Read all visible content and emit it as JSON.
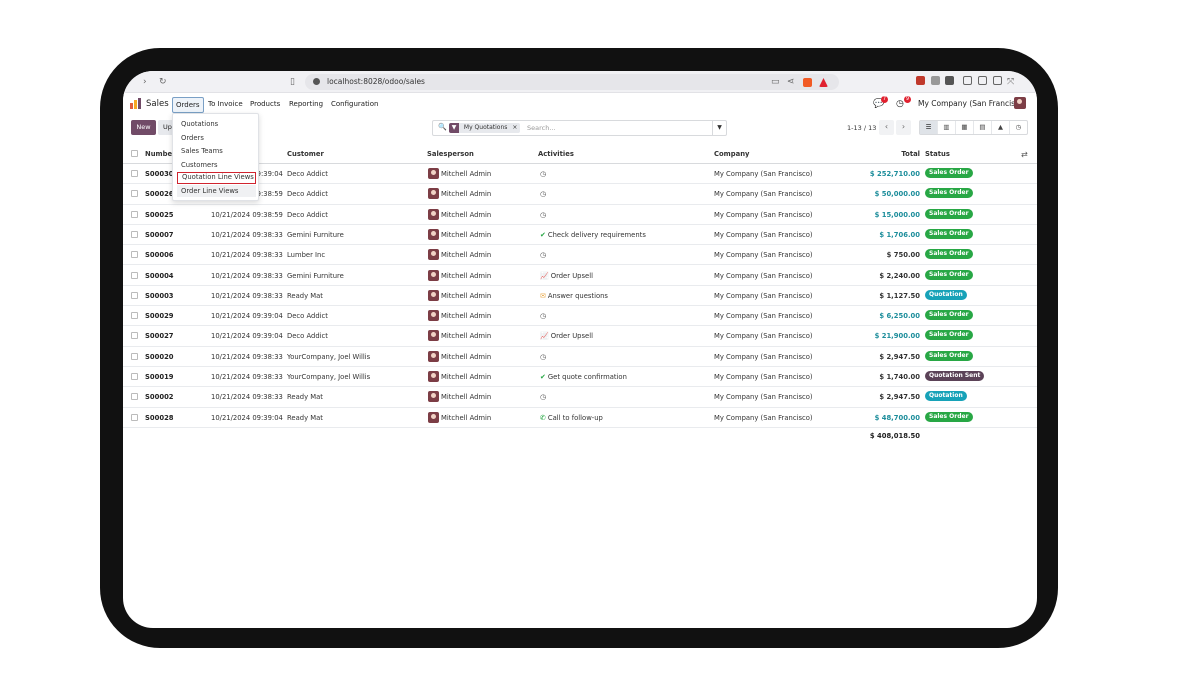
{
  "browser": {
    "url": "localhost:8028/odoo/sales"
  },
  "navbar": {
    "app_name": "Sales",
    "menus": [
      "Orders",
      "To Invoice",
      "Products",
      "Reporting",
      "Configuration"
    ],
    "badge_messages": "7",
    "badge_activities": "9",
    "company": "My Company (San Francisco)"
  },
  "toolbar": {
    "new_label": "New",
    "upload_label": "Up",
    "facet_label": "My Quotations",
    "search_placeholder": "Search...",
    "pager": "1-13 / 13"
  },
  "dropdown": {
    "items": [
      "Quotations",
      "Orders",
      "Sales Teams",
      "Customers",
      "Quotation Line Views",
      "Order Line Views"
    ]
  },
  "table": {
    "headers": {
      "number": "Number",
      "customer": "Customer",
      "salesperson": "Salesperson",
      "activities": "Activities",
      "company": "Company",
      "total": "Total",
      "status": "Status"
    },
    "rows": [
      {
        "number": "S00030",
        "date": "10/21/2024 09:39:04",
        "customer": "Deco Addict",
        "salesperson": "Mitchell Admin",
        "activity": "",
        "activity_icon": "clock-icon",
        "company": "My Company (San Francisco)",
        "total": "$ 252,710.00",
        "total_teal": true,
        "status": "Sales Order",
        "status_kind": "so"
      },
      {
        "number": "S00026",
        "date": "10/21/2024 09:38:59",
        "customer": "Deco Addict",
        "salesperson": "Mitchell Admin",
        "activity": "",
        "activity_icon": "clock-icon",
        "company": "My Company (San Francisco)",
        "total": "$ 50,000.00",
        "total_teal": true,
        "status": "Sales Order",
        "status_kind": "so"
      },
      {
        "number": "S00025",
        "date": "10/21/2024 09:38:59",
        "customer": "Deco Addict",
        "salesperson": "Mitchell Admin",
        "activity": "",
        "activity_icon": "clock-icon",
        "company": "My Company (San Francisco)",
        "total": "$ 15,000.00",
        "total_teal": true,
        "status": "Sales Order",
        "status_kind": "so"
      },
      {
        "number": "S00007",
        "date": "10/21/2024 09:38:33",
        "customer": "Gemini Furniture",
        "salesperson": "Mitchell Admin",
        "activity": "Check delivery requirements",
        "activity_icon": "check-icon",
        "company": "My Company (San Francisco)",
        "total": "$ 1,706.00",
        "total_teal": true,
        "status": "Sales Order",
        "status_kind": "so"
      },
      {
        "number": "S00006",
        "date": "10/21/2024 09:38:33",
        "customer": "Lumber Inc",
        "salesperson": "Mitchell Admin",
        "activity": "",
        "activity_icon": "clock-icon",
        "company": "My Company (San Francisco)",
        "total": "$ 750.00",
        "total_teal": false,
        "status": "Sales Order",
        "status_kind": "so"
      },
      {
        "number": "S00004",
        "date": "10/21/2024 09:38:33",
        "customer": "Gemini Furniture",
        "salesperson": "Mitchell Admin",
        "activity": "Order Upsell",
        "activity_icon": "chart-icon",
        "company": "My Company (San Francisco)",
        "total": "$ 2,240.00",
        "total_teal": false,
        "status": "Sales Order",
        "status_kind": "so"
      },
      {
        "number": "S00003",
        "date": "10/21/2024 09:38:33",
        "customer": "Ready Mat",
        "salesperson": "Mitchell Admin",
        "activity": "Answer questions",
        "activity_icon": "envelope-icon",
        "company": "My Company (San Francisco)",
        "total": "$ 1,127.50",
        "total_teal": false,
        "status": "Quotation",
        "status_kind": "q"
      },
      {
        "number": "S00029",
        "date": "10/21/2024 09:39:04",
        "customer": "Deco Addict",
        "salesperson": "Mitchell Admin",
        "activity": "",
        "activity_icon": "clock-icon",
        "company": "My Company (San Francisco)",
        "total": "$ 6,250.00",
        "total_teal": true,
        "status": "Sales Order",
        "status_kind": "so"
      },
      {
        "number": "S00027",
        "date": "10/21/2024 09:39:04",
        "customer": "Deco Addict",
        "salesperson": "Mitchell Admin",
        "activity": "Order Upsell",
        "activity_icon": "chart-icon",
        "company": "My Company (San Francisco)",
        "total": "$ 21,900.00",
        "total_teal": true,
        "status": "Sales Order",
        "status_kind": "so"
      },
      {
        "number": "S00020",
        "date": "10/21/2024 09:38:33",
        "customer": "YourCompany, Joel Willis",
        "salesperson": "Mitchell Admin",
        "activity": "",
        "activity_icon": "clock-icon",
        "company": "My Company (San Francisco)",
        "total": "$ 2,947.50",
        "total_teal": false,
        "status": "Sales Order",
        "status_kind": "so"
      },
      {
        "number": "S00019",
        "date": "10/21/2024 09:38:33",
        "customer": "YourCompany, Joel Willis",
        "salesperson": "Mitchell Admin",
        "activity": "Get quote confirmation",
        "activity_icon": "check-icon",
        "company": "My Company (San Francisco)",
        "total": "$ 1,740.00",
        "total_teal": false,
        "status": "Quotation Sent",
        "status_kind": "qs"
      },
      {
        "number": "S00002",
        "date": "10/21/2024 09:38:33",
        "customer": "Ready Mat",
        "salesperson": "Mitchell Admin",
        "activity": "",
        "activity_icon": "clock-icon",
        "company": "My Company (San Francisco)",
        "total": "$ 2,947.50",
        "total_teal": false,
        "status": "Quotation",
        "status_kind": "q"
      },
      {
        "number": "S00028",
        "date": "10/21/2024 09:39:04",
        "customer": "Ready Mat",
        "salesperson": "Mitchell Admin",
        "activity": "Call to follow-up",
        "activity_icon": "phone-icon",
        "company": "My Company (San Francisco)",
        "total": "$ 48,700.00",
        "total_teal": true,
        "status": "Sales Order",
        "status_kind": "so"
      }
    ],
    "grand_total": "$ 408,018.50"
  }
}
